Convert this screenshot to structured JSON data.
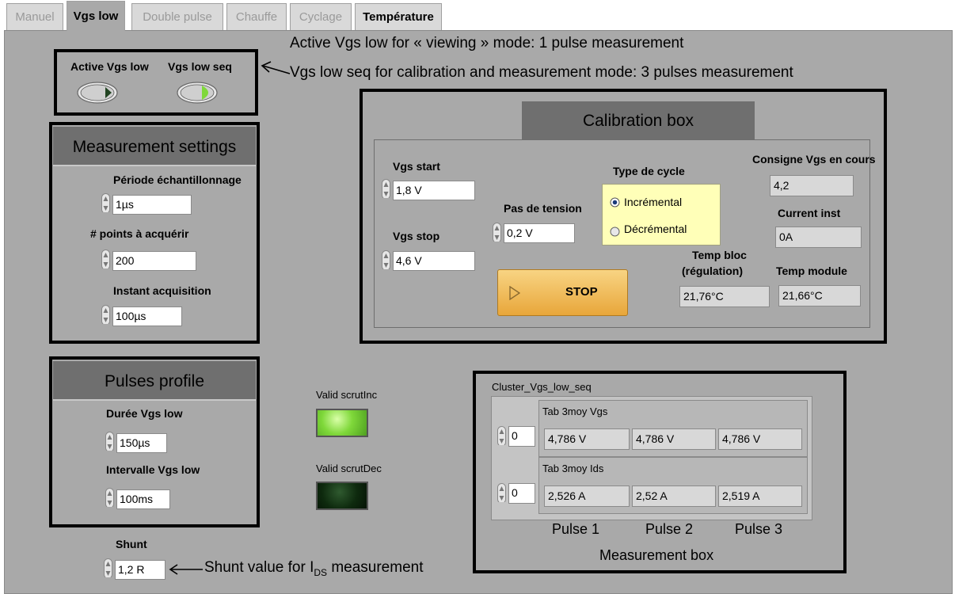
{
  "tabs": [
    "Manuel",
    "Vgs low",
    "Double pulse",
    "Chauffe",
    "Cyclage",
    "Température"
  ],
  "annotations": {
    "active_vgs": "Active Vgs low for « viewing » mode: 1 pulse measurement",
    "vgs_seq": "Vgs low seq for calibration and measurement mode: 3 pulses measurement",
    "shunt_pre": "Shunt value for I",
    "shunt_sub": "DS",
    "shunt_post": " measurement",
    "measurement_box": "Measurement box",
    "pulse_labels": [
      "Pulse 1",
      "Pulse 2",
      "Pulse 3"
    ]
  },
  "buttons": {
    "active_vgs_low": "Active Vgs low",
    "vgs_low_seq": "Vgs low seq"
  },
  "measurement_settings": {
    "title": "Measurement settings",
    "periode_label": "Période échantillonnage",
    "periode_value": "1µs",
    "points_label": "# points à acquérir",
    "points_value": "200",
    "instant_label": "Instant acquisition",
    "instant_value": "100µs"
  },
  "pulses_profile": {
    "title": "Pulses profile",
    "duree_label": "Durée Vgs low",
    "duree_value": "150µs",
    "intervalle_label": "Intervalle Vgs low",
    "intervalle_value": "100ms"
  },
  "shunt": {
    "label": "Shunt",
    "value": "1,2 R"
  },
  "calibration": {
    "title": "Calibration box",
    "vgs_start_label": "Vgs start",
    "vgs_start_value": "1,8 V",
    "vgs_stop_label": "Vgs stop",
    "vgs_stop_value": "4,6 V",
    "pas_label": "Pas de tension",
    "pas_value": "0,2 V",
    "type_label": "Type de cycle",
    "incremental": "Incrémental",
    "decremental": "Décrémental",
    "stop_label": "STOP",
    "consigne_label": "Consigne Vgs en cours",
    "consigne_value": "4,2",
    "current_label": "Current inst",
    "current_value": "0A",
    "temp_bloc_label1": "Temp bloc",
    "temp_bloc_label2": "(régulation)",
    "temp_bloc_value": "21,76°C",
    "temp_module_label": "Temp module",
    "temp_module_value": "21,66°C"
  },
  "valid": {
    "inc_label": "Valid scrutInc",
    "dec_label": "Valid scrutDec"
  },
  "cluster": {
    "title": "Cluster_Vgs_low_seq",
    "vgs_label": "Tab 3moy Vgs",
    "vgs_index": "0",
    "vgs_values": [
      "4,786 V",
      "4,786 V",
      "4,786 V"
    ],
    "ids_label": "Tab 3moy Ids",
    "ids_index": "0",
    "ids_values": [
      "2,526 A",
      "2,52 A",
      "2,519 A"
    ]
  },
  "colors": {
    "panel": "#a9a9a9",
    "header": "#6f6f6f",
    "led_on": "#7fd83a",
    "led_off": "#0e2a0e",
    "stop_button": "#f2b84a",
    "radio_group": "#ffffb8"
  }
}
